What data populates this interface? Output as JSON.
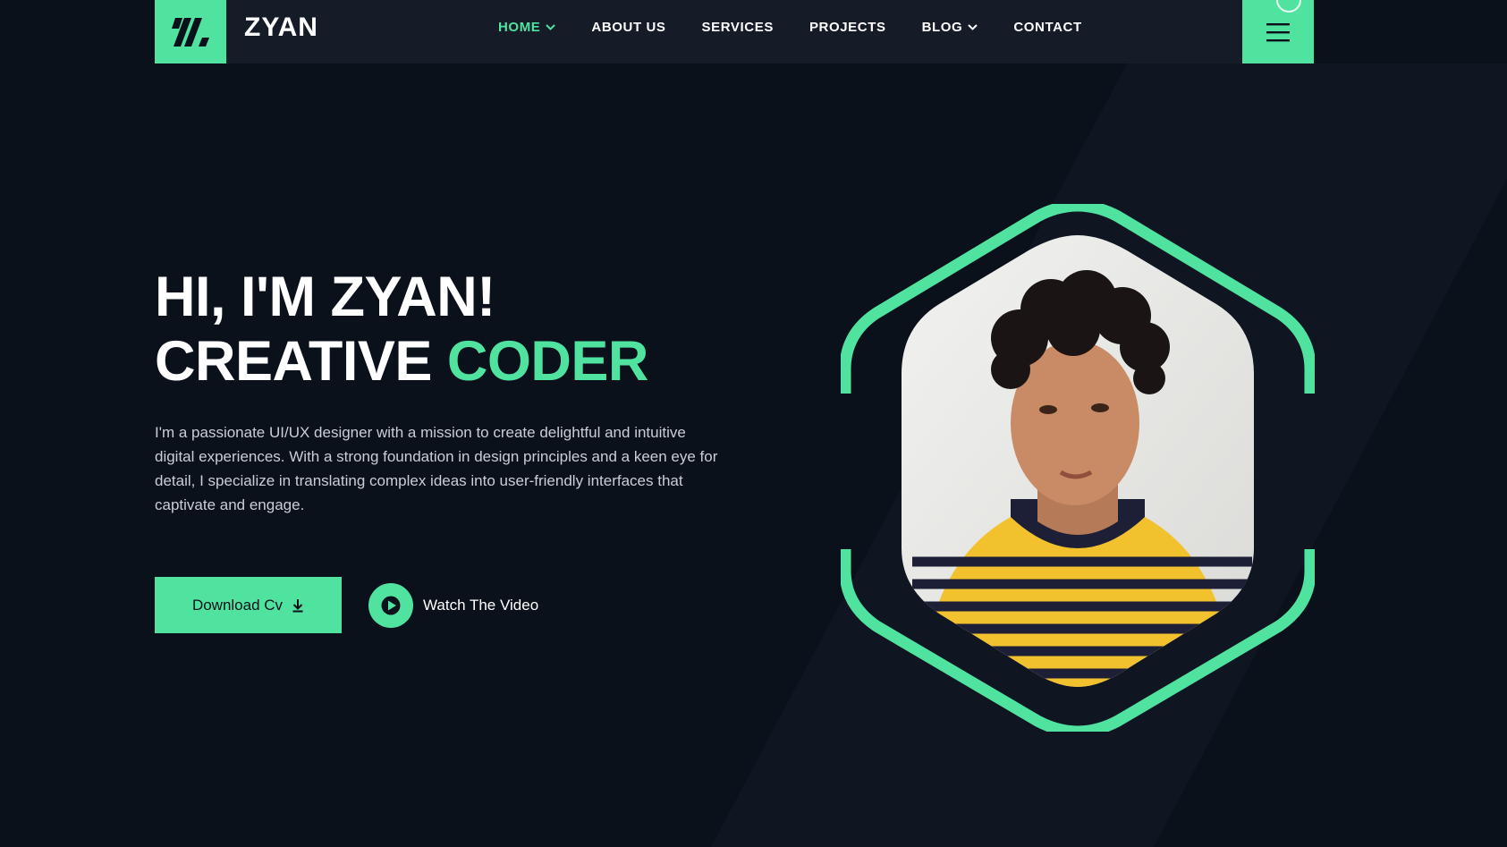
{
  "colors": {
    "accent": "#50e3a0",
    "background": "#0b111b",
    "header": "#151c27"
  },
  "header": {
    "brand": "ZYAN",
    "logo_icon": "slashes-logo-icon",
    "menu_icon": "hamburger-menu-icon"
  },
  "nav": {
    "items": [
      {
        "label": "HOME",
        "active": true,
        "dropdown": true
      },
      {
        "label": "ABOUT US"
      },
      {
        "label": "SERVICES"
      },
      {
        "label": "PROJECTS"
      },
      {
        "label": "BLOG",
        "dropdown": true
      },
      {
        "label": "CONTACT"
      }
    ]
  },
  "hero": {
    "line1": "HI, I'M ZYAN!",
    "line2_prefix": "CREATIVE ",
    "line2_accent": "CODER",
    "description": "I'm a passionate UI/UX designer with a mission to create delightful and intuitive digital experiences. With a strong foundation in design principles and a keen eye for detail, I specialize in translating complex ideas into user-friendly interfaces that captivate and engage.",
    "download_label": "Download Cv",
    "download_icon": "download-icon",
    "video_label": "Watch The Video",
    "video_icon": "play-icon"
  }
}
